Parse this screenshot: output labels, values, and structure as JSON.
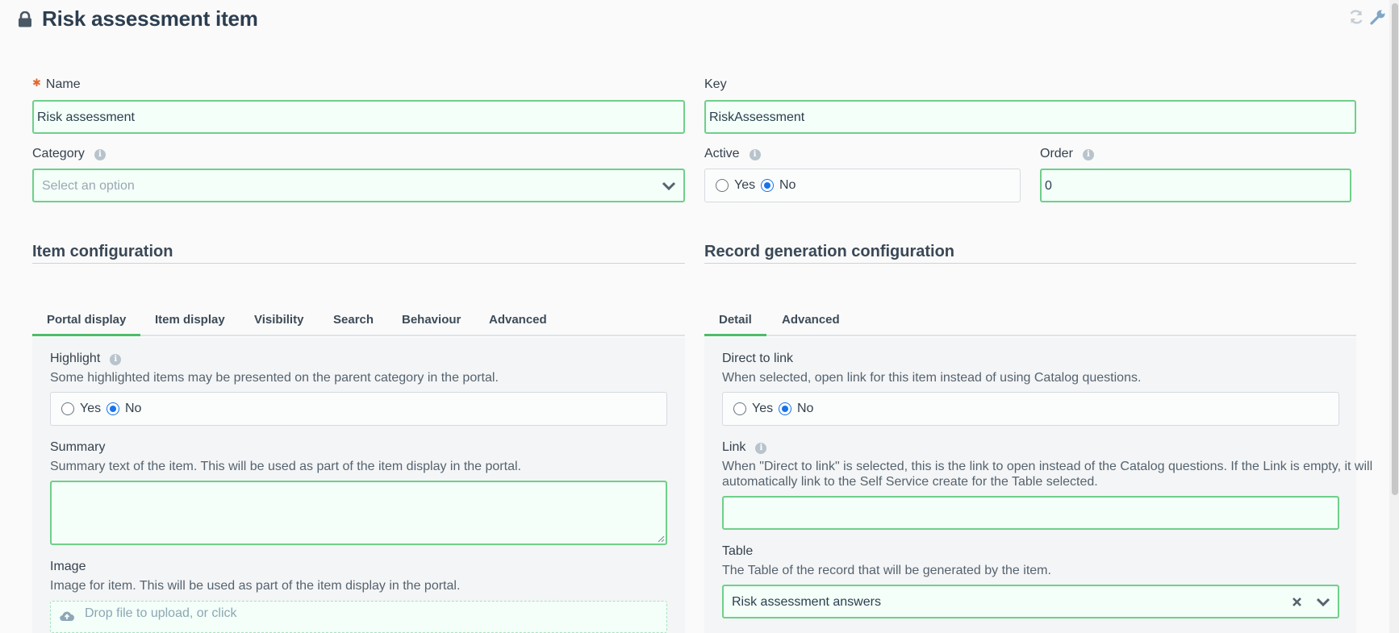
{
  "header": {
    "title": "Risk assessment item",
    "icons": [
      "lock-icon",
      "refresh-icon",
      "wrench-icon"
    ]
  },
  "form": {
    "name": {
      "label": "Name",
      "value": "Risk assessment",
      "required": true
    },
    "key": {
      "label": "Key",
      "value": "RiskAssessment"
    },
    "category": {
      "label": "Category",
      "placeholder": "Select an option"
    },
    "active": {
      "label": "Active",
      "yes": "Yes",
      "no": "No",
      "selected": "No"
    },
    "order": {
      "label": "Order",
      "value": "0"
    }
  },
  "item_config": {
    "title": "Item configuration",
    "tabs": [
      "Portal display",
      "Item display",
      "Visibility",
      "Search",
      "Behaviour",
      "Advanced"
    ],
    "active_tab": "Portal display",
    "highlight": {
      "label": "Highlight",
      "desc": "Some highlighted items may be presented on the parent category in the portal.",
      "yes": "Yes",
      "no": "No",
      "selected": "No"
    },
    "summary": {
      "label": "Summary",
      "desc": "Summary text of the item. This will be used as part of the item display in the portal.",
      "value": ""
    },
    "image": {
      "label": "Image",
      "desc": "Image for item. This will be used as part of the item display in the portal.",
      "dropzone": "Drop file to upload, or click"
    }
  },
  "record_config": {
    "title": "Record generation configuration",
    "tabs": [
      "Detail",
      "Advanced"
    ],
    "active_tab": "Detail",
    "direct_link": {
      "label": "Direct to link",
      "desc": "When selected, open link for this item instead of using Catalog questions.",
      "yes": "Yes",
      "no": "No",
      "selected": "No"
    },
    "link": {
      "label": "Link",
      "desc_line1": "When \"Direct to link\" is selected, this is the link to open instead of the Catalog questions. If the Link is empty, it will",
      "desc_line2": "automatically link to the Self Service create for the Table selected.",
      "value": ""
    },
    "table": {
      "label": "Table",
      "desc": "The Table of the record that will be generated by the item.",
      "value": "Risk assessment answers"
    }
  },
  "colors": {
    "accent_green": "#4cbd6a",
    "field_border": "#6fcf8a",
    "radio_blue": "#1a73e8",
    "required_star": "#e8652b"
  }
}
